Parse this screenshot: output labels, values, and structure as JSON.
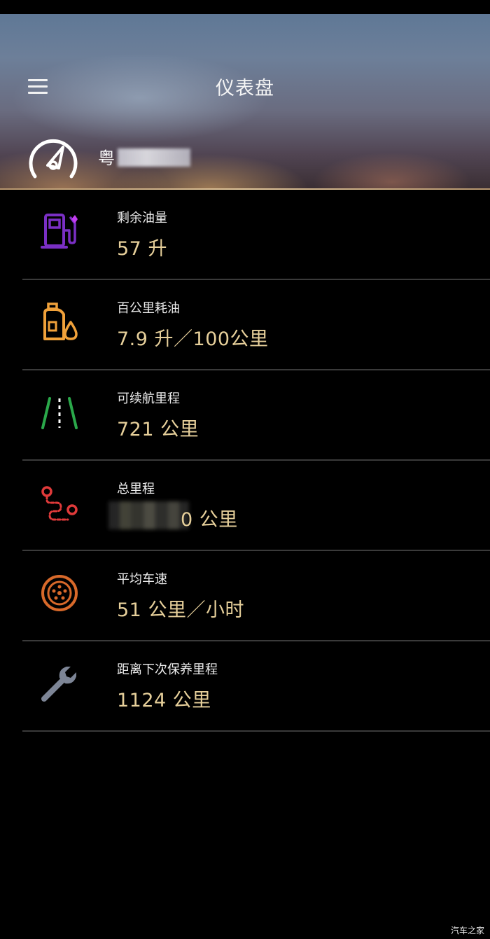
{
  "header": {
    "title": "仪表盘",
    "plate_prefix": "粤"
  },
  "items": [
    {
      "label": "剩余油量",
      "value": "57 升",
      "icon": "fuel-pump-icon",
      "color": "#7a2fc4"
    },
    {
      "label": "百公里耗油",
      "value": "7.9 升／100公里",
      "icon": "oil-can-icon",
      "color": "#f0a13a"
    },
    {
      "label": "可续航里程",
      "value": "721 公里",
      "icon": "road-icon",
      "color": "#2aa84a"
    },
    {
      "label": "总里程",
      "value": "0 公里",
      "icon": "route-icon",
      "color": "#e03a3a"
    },
    {
      "label": "平均车速",
      "value": "51 公里／小时",
      "icon": "wheel-icon",
      "color": "#d8692a"
    },
    {
      "label": "距离下次保养里程",
      "value": "1124 公里",
      "icon": "wrench-icon",
      "color": "#7d8596"
    }
  ],
  "watermark": "汽车之家"
}
